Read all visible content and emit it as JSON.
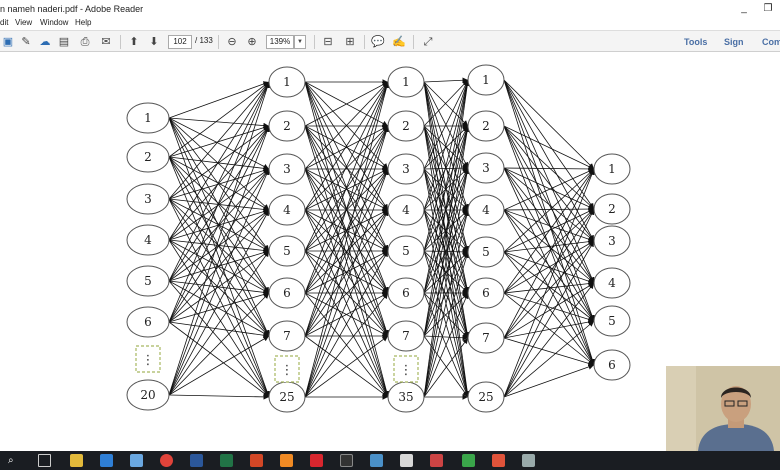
{
  "window": {
    "title": "n nameh naderi.pdf - Adobe Reader",
    "controls": {
      "minimize": "_",
      "restore": "❐"
    }
  },
  "menu": [
    "dit",
    "View",
    "Window",
    "Help"
  ],
  "toolbar": {
    "page_current": "102",
    "page_total": "/ 133",
    "zoom": "139%",
    "links": [
      "Tools",
      "Sign",
      "Com"
    ]
  },
  "network": {
    "layers": [
      {
        "labels": [
          "1",
          "2",
          "3",
          "4",
          "5",
          "6",
          "20"
        ],
        "ellipsis_before_last": true
      },
      {
        "labels": [
          "1",
          "2",
          "3",
          "4",
          "5",
          "6",
          "7",
          "25"
        ],
        "ellipsis_before_last": true
      },
      {
        "labels": [
          "1",
          "2",
          "3",
          "4",
          "5",
          "6",
          "7",
          "35"
        ],
        "ellipsis_before_last": true
      },
      {
        "labels": [
          "1",
          "2",
          "3",
          "4",
          "5",
          "6",
          "7",
          "25"
        ],
        "ellipsis_before_last": false
      },
      {
        "labels": [
          "1",
          "2",
          "3",
          "4",
          "5",
          "6"
        ],
        "ellipsis_before_last": false
      }
    ],
    "ellipsis_symbol": "⋮"
  },
  "colors": {
    "node_stroke": "#555555",
    "edge": "#111111",
    "ellipsis_box": "#a8b860",
    "toolbar_link": "#4a6fa5",
    "taskbar": "#1a1d22"
  }
}
